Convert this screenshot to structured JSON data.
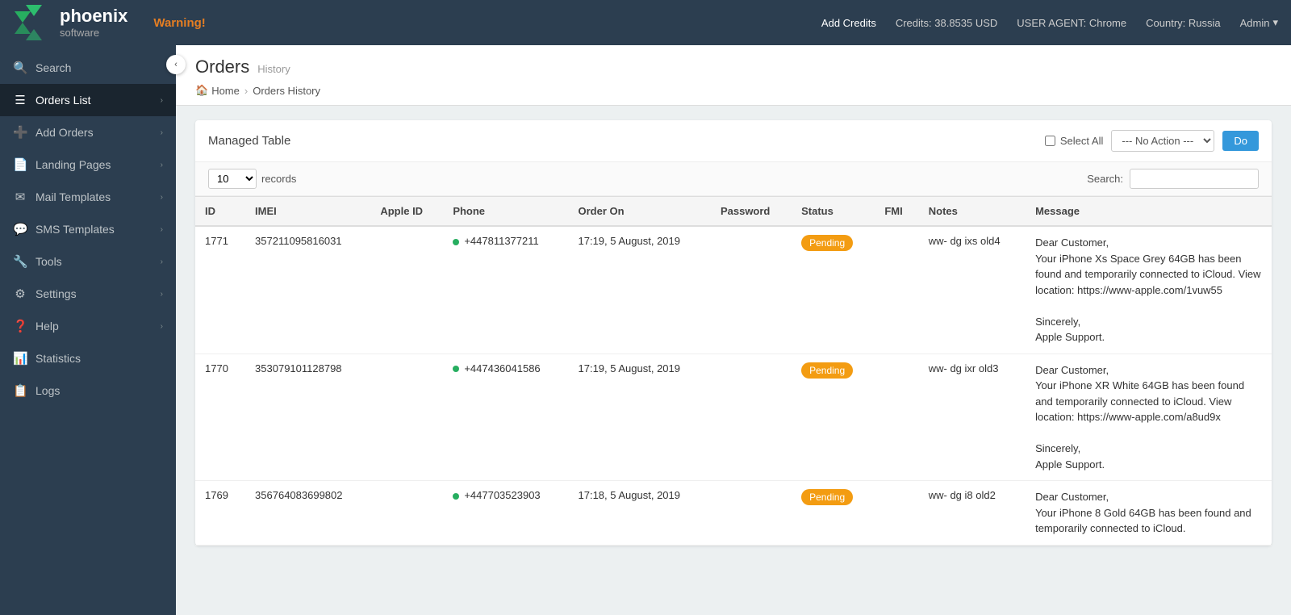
{
  "topbar": {
    "brand": "phoenix",
    "sub": "software",
    "warning": "Warning!",
    "add_credits": "Add Credits",
    "credits": "Credits: 38.8535 USD",
    "user_agent": "USER AGENT: Chrome",
    "country": "Country: Russia",
    "admin": "Admin"
  },
  "sidebar": {
    "toggle_icon": "‹",
    "items": [
      {
        "id": "search",
        "label": "Search",
        "icon": "🔍",
        "arrow": true
      },
      {
        "id": "orders-list",
        "label": "Orders List",
        "icon": "☰",
        "arrow": true
      },
      {
        "id": "add-orders",
        "label": "Add Orders",
        "icon": "➕",
        "arrow": true
      },
      {
        "id": "landing-pages",
        "label": "Landing Pages",
        "icon": "📄",
        "arrow": true
      },
      {
        "id": "mail-templates",
        "label": "Mail Templates",
        "icon": "✉",
        "arrow": true
      },
      {
        "id": "sms-templates",
        "label": "SMS Templates",
        "icon": "💬",
        "arrow": true
      },
      {
        "id": "tools",
        "label": "Tools",
        "icon": "🔧",
        "arrow": true
      },
      {
        "id": "settings",
        "label": "Settings",
        "icon": "⚙",
        "arrow": true
      },
      {
        "id": "help",
        "label": "Help",
        "icon": "❓",
        "arrow": true
      },
      {
        "id": "statistics",
        "label": "Statistics",
        "icon": "📊",
        "arrow": false
      },
      {
        "id": "logs",
        "label": "Logs",
        "icon": "📋",
        "arrow": false
      }
    ]
  },
  "page": {
    "title": "Orders",
    "subtitle": "History",
    "breadcrumb_home": "Home",
    "breadcrumb_current": "Orders History"
  },
  "managed_table": {
    "title": "Managed Table",
    "select_all_label": "Select All",
    "no_action_label": "--- No Action ---",
    "do_label": "Do",
    "records_label": "records",
    "search_label": "Search:"
  },
  "table": {
    "columns": [
      "ID",
      "IMEI",
      "Apple ID",
      "Phone",
      "Order On",
      "Password",
      "Status",
      "FMI",
      "Notes",
      "Message"
    ],
    "rows": [
      {
        "id": "1771",
        "imei": "357211095816031",
        "apple_id": "",
        "phone": "+447811377211",
        "order_on": "17:19, 5 August, 2019",
        "password": "",
        "status": "Pending",
        "fmi": "",
        "notes": "ww- dg ixs old4",
        "message": "Dear Customer,\nYour iPhone Xs Space Grey 64GB has been found and temporarily connected to iCloud. View location: https://www-apple.com/1vuw55\n\nSincerely,\nApple Support."
      },
      {
        "id": "1770",
        "imei": "353079101128798",
        "apple_id": "",
        "phone": "+447436041586",
        "order_on": "17:19, 5 August, 2019",
        "password": "",
        "status": "Pending",
        "fmi": "",
        "notes": "ww- dg ixr old3",
        "message": "Dear Customer,\nYour iPhone XR White 64GB has been found and temporarily connected to iCloud. View location: https://www-apple.com/a8ud9x\n\nSincerely,\nApple Support."
      },
      {
        "id": "1769",
        "imei": "356764083699802",
        "apple_id": "",
        "phone": "+447703523903",
        "order_on": "17:18, 5 August, 2019",
        "password": "",
        "status": "Pending",
        "fmi": "",
        "notes": "ww- dg i8 old2",
        "message": "Dear Customer,\nYour iPhone 8 Gold 64GB has been found and temporarily connected to iCloud."
      }
    ]
  }
}
